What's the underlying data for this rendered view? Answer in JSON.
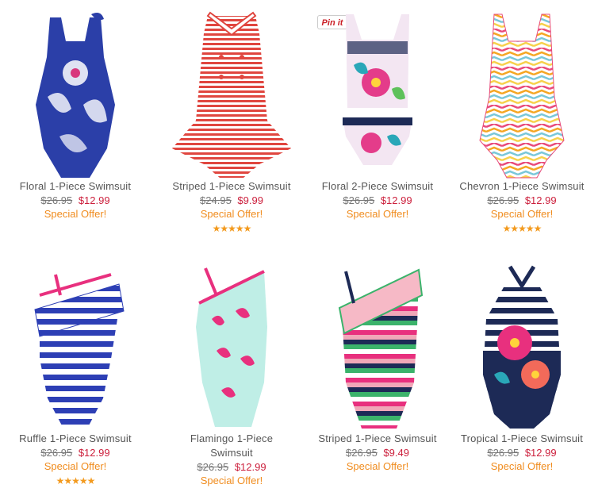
{
  "products": [
    {
      "name": "Floral 1-Piece Swimsuit",
      "old_price": "$26.95",
      "sale_price": "$12.99",
      "offer": "Special Offer!",
      "rating": 0
    },
    {
      "name": "Striped 1-Piece Swimsuit",
      "old_price": "$24.95",
      "sale_price": "$9.99",
      "offer": "Special Offer!",
      "rating": 5
    },
    {
      "name": "Floral 2-Piece Swimsuit",
      "old_price": "$26.95",
      "sale_price": "$12.99",
      "offer": "Special Offer!",
      "rating": 0
    },
    {
      "name": "Chevron 1-Piece Swimsuit",
      "old_price": "$26.95",
      "sale_price": "$12.99",
      "offer": "Special Offer!",
      "rating": 5
    },
    {
      "name": "Ruffle 1-Piece Swimsuit",
      "old_price": "$26.95",
      "sale_price": "$12.99",
      "offer": "Special Offer!",
      "rating": 5
    },
    {
      "name_line1": "Flamingo 1-Piece",
      "name_line2": "Swimsuit",
      "old_price": "$26.95",
      "sale_price": "$12.99",
      "offer": "Special Offer!",
      "rating": 0
    },
    {
      "name": "Striped 1-Piece Swimsuit",
      "old_price": "$26.95",
      "sale_price": "$9.49",
      "offer": "Special Offer!",
      "rating": 0
    },
    {
      "name": "Tropical 1-Piece Swimsuit",
      "old_price": "$26.95",
      "sale_price": "$12.99",
      "offer": "Special Offer!",
      "rating": 0
    }
  ],
  "pin_button": {
    "label": "Pin it",
    "icon": "pinterest-icon"
  },
  "colors": {
    "sale": "#cc1f3c",
    "offer": "#f08c1e",
    "stars": "#f39a1e",
    "name": "#555555"
  }
}
